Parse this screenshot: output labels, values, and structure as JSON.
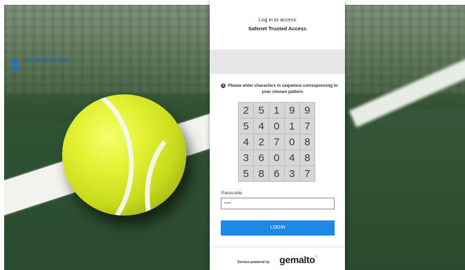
{
  "header": {
    "line1": "Log in to access",
    "line2": "Safenet Trusted Access"
  },
  "user": {
    "email": "east@trustseb.com",
    "icon": "user-icon"
  },
  "instruction": {
    "icon": "info-icon",
    "text": "Please enter characters in sequence corresponcing to your chosen pattern."
  },
  "grid": [
    [
      "2",
      "5",
      "1",
      "9",
      "9"
    ],
    [
      "5",
      "4",
      "0",
      "1",
      "7"
    ],
    [
      "4",
      "2",
      "7",
      "0",
      "8"
    ],
    [
      "3",
      "6",
      "0",
      "4",
      "8"
    ],
    [
      "5",
      "8",
      "6",
      "3",
      "7"
    ]
  ],
  "passcode": {
    "label": "Passcode",
    "value": "••••"
  },
  "login_button": "LOGIN",
  "footer": {
    "service_text": "Service powered by",
    "brand": "gemalto"
  },
  "colors": {
    "accent": "#1e88e5",
    "email_link": "#1565c0",
    "brand_dot": "#f0a000"
  }
}
